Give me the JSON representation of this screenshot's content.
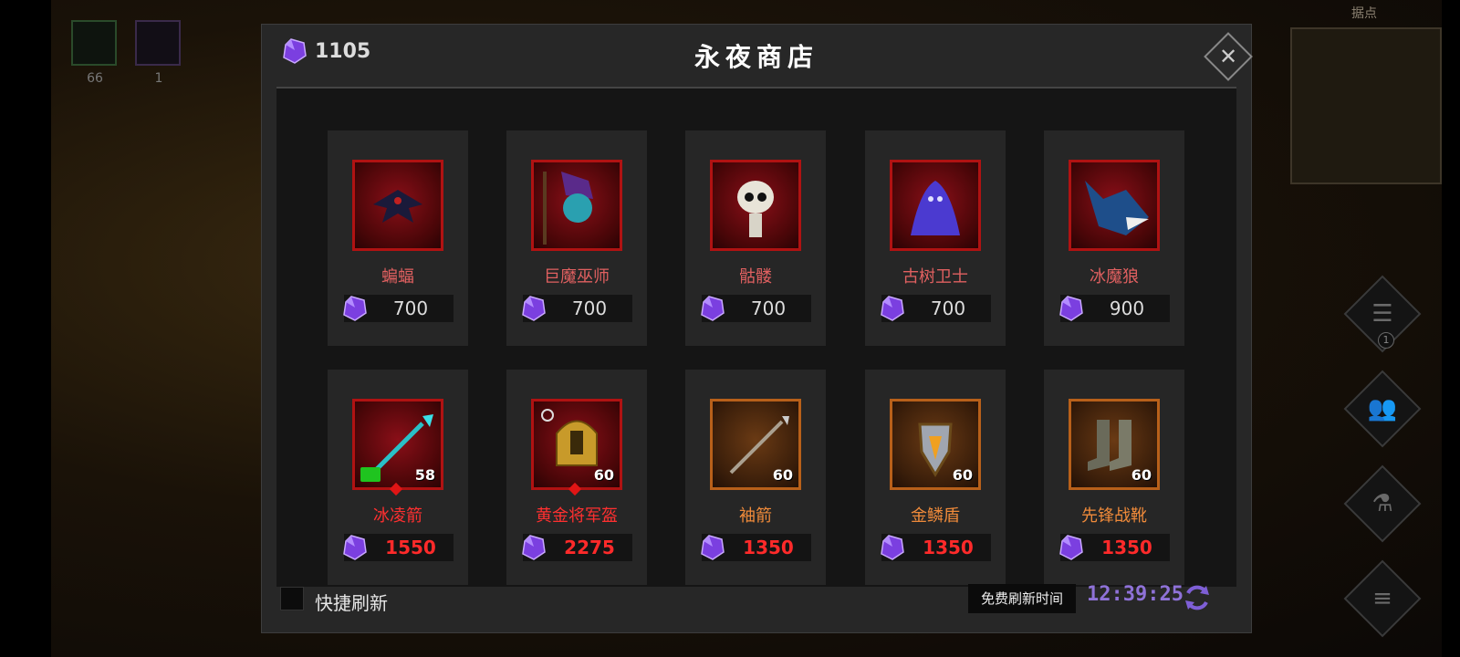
{
  "hud": {
    "slot1_count": "66",
    "slot2_count": "1",
    "minimap_label": "据点",
    "scroll_badge": "1"
  },
  "shop": {
    "title": "永夜商店",
    "currency": "1105",
    "currency_icon": "purple-gem-icon",
    "close_icon": "close-icon",
    "quick_refresh_label": "快捷刷新",
    "free_refresh_label": "免费刷新时间",
    "timer": "12:39:25",
    "colors": {
      "gem": "#7b3fe0",
      "timer": "#8f72d8",
      "unaffordable_price": "#ff2a2a",
      "frame_red": "#b01212",
      "frame_orange": "#b8601a"
    }
  },
  "items": [
    {
      "name": "蝙蝠",
      "price": "700",
      "icon": "bat-icon",
      "level": "",
      "rarity": "red"
    },
    {
      "name": "巨魔巫师",
      "price": "700",
      "icon": "troll-wizard-icon",
      "level": "",
      "rarity": "red"
    },
    {
      "name": "骷髅",
      "price": "700",
      "icon": "skeleton-icon",
      "level": "",
      "rarity": "red"
    },
    {
      "name": "古树卫士",
      "price": "700",
      "icon": "ancient-tree-guardian-icon",
      "level": "",
      "rarity": "red"
    },
    {
      "name": "冰魔狼",
      "price": "900",
      "icon": "ice-wolf-icon",
      "level": "",
      "rarity": "red"
    },
    {
      "name": "冰凌箭",
      "price": "1550",
      "icon": "ice-arrow-icon",
      "level": "58",
      "rarity": "red"
    },
    {
      "name": "黄金将军盔",
      "price": "2275",
      "icon": "golden-helmet-icon",
      "level": "60",
      "rarity": "red"
    },
    {
      "name": "袖箭",
      "price": "1350",
      "icon": "sleeve-arrow-icon",
      "level": "60",
      "rarity": "orange"
    },
    {
      "name": "金鳞盾",
      "price": "1350",
      "icon": "golden-scale-shield-icon",
      "level": "60",
      "rarity": "orange"
    },
    {
      "name": "先锋战靴",
      "price": "1350",
      "icon": "vanguard-boots-icon",
      "level": "60",
      "rarity": "orange"
    }
  ]
}
